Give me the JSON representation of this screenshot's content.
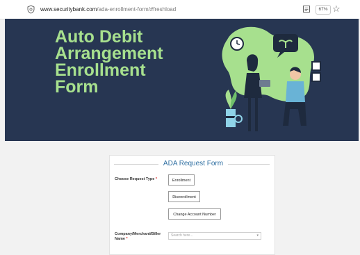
{
  "browser": {
    "url_host": "www.securitybank.com",
    "url_path": "/ada-enrollment-form/#freshload",
    "zoom": "67%"
  },
  "hero": {
    "title_lines": [
      "Auto Debit",
      "Arrangement",
      "Enrollment",
      "Form"
    ]
  },
  "form": {
    "legend": "ADA Request Form",
    "request_type_label": "Choose Request Type",
    "request_type_required": "*",
    "buttons": {
      "enrollment": "Enrollment",
      "disenrollment": "Disenrollment",
      "change_account_number": "Change Account Number"
    },
    "company_label": "Company/Merchant/Biller Name",
    "company_required": "*",
    "company_placeholder": "Search here..."
  },
  "colors": {
    "hero_bg": "#273652",
    "title_green": "#a7e08e",
    "legend_blue": "#2d6ea1"
  }
}
